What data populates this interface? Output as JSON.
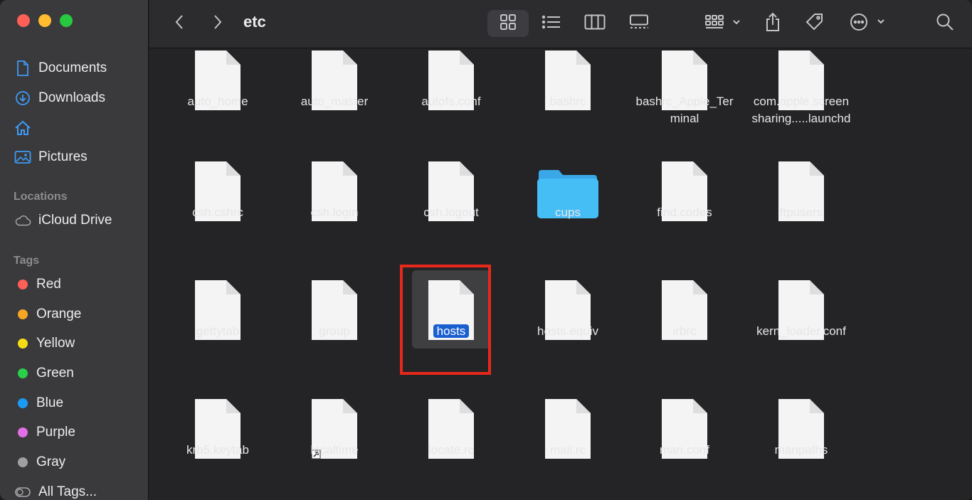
{
  "window": {
    "title": "etc"
  },
  "sidebar": {
    "favorites": [
      {
        "label": "Documents",
        "icon": "document-icon"
      },
      {
        "label": "Downloads",
        "icon": "download-icon"
      },
      {
        "label": "",
        "icon": "home-icon"
      },
      {
        "label": "Pictures",
        "icon": "pictures-icon"
      }
    ],
    "locations_header": "Locations",
    "locations": [
      {
        "label": "iCloud Drive",
        "icon": "cloud-icon"
      }
    ],
    "tags_header": "Tags",
    "tags": [
      {
        "label": "Red",
        "color": "#fe5f57"
      },
      {
        "label": "Orange",
        "color": "#f6a623"
      },
      {
        "label": "Yellow",
        "color": "#f5dd16"
      },
      {
        "label": "Green",
        "color": "#2ad04a"
      },
      {
        "label": "Blue",
        "color": "#1c9bf5"
      },
      {
        "label": "Purple",
        "color": "#e36ee6"
      },
      {
        "label": "Gray",
        "color": "#a0a0a3"
      }
    ],
    "all_tags": "All Tags..."
  },
  "files": [
    {
      "name": "auto_home",
      "type": "file"
    },
    {
      "name": "auto_master",
      "type": "file"
    },
    {
      "name": "autofs.conf",
      "type": "file"
    },
    {
      "name": "bashrc",
      "type": "file"
    },
    {
      "name": "bashrc_Apple_Ter minal",
      "type": "file"
    },
    {
      "name": "com.apple.screen sharing.....launchd",
      "type": "file"
    },
    {
      "name": "csh.cshrc",
      "type": "file"
    },
    {
      "name": "csh.login",
      "type": "file"
    },
    {
      "name": "csh.logout",
      "type": "file"
    },
    {
      "name": "cups",
      "type": "folder"
    },
    {
      "name": "find.codes",
      "type": "file"
    },
    {
      "name": "ftpusers",
      "type": "file"
    },
    {
      "name": "gettytab",
      "type": "file"
    },
    {
      "name": "group",
      "type": "file"
    },
    {
      "name": "hosts",
      "type": "file",
      "selected": true
    },
    {
      "name": "hosts.equiv",
      "type": "file"
    },
    {
      "name": "irbrc",
      "type": "file"
    },
    {
      "name": "kern_loader.conf",
      "type": "file"
    },
    {
      "name": "krb5.keytab",
      "type": "file"
    },
    {
      "name": "localtime",
      "type": "alias"
    },
    {
      "name": "locate.rc",
      "type": "file"
    },
    {
      "name": "mail.rc",
      "type": "file"
    },
    {
      "name": "man.conf",
      "type": "file"
    },
    {
      "name": "manpaths",
      "type": "file"
    }
  ]
}
